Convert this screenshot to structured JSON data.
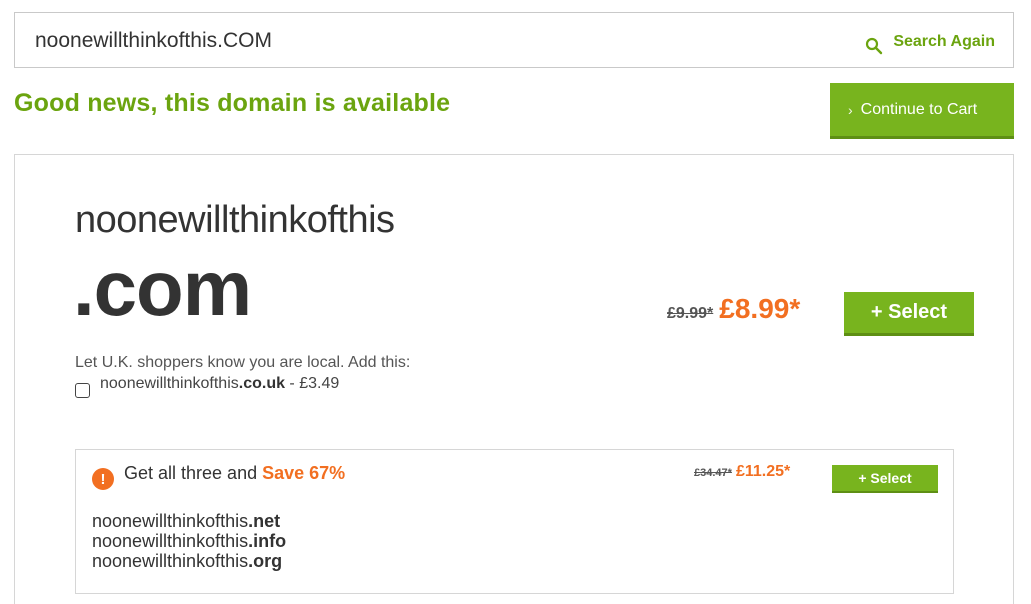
{
  "search": {
    "value": "noonewillthinkofthis.COM",
    "again_label": "Search Again"
  },
  "result": {
    "headline": "Good news, this domain is available",
    "continue_label": "Continue to Cart",
    "domain_name": "noonewillthinkofthis",
    "tld": ".com",
    "old_price": "£9.99*",
    "new_price": "£8.99*",
    "select_label": "+ Select"
  },
  "local": {
    "note": "Let U.K. shoppers know you are local. Add this:",
    "name": "noonewillthinkofthis",
    "tld": ".co.uk",
    "price": " - £3.49"
  },
  "bundle": {
    "title": "Get all three and ",
    "save": "Save 67%",
    "old_price": "£34.47*",
    "new_price": "£11.25*",
    "select_label": "+ Select",
    "items": [
      {
        "name": "noonewillthinkofthis",
        "tld": ".net"
      },
      {
        "name": "noonewillthinkofthis",
        "tld": ".info"
      },
      {
        "name": "noonewillthinkofthis",
        "tld": ".org"
      }
    ]
  },
  "colors": {
    "brand_green": "#78b41e",
    "headline_green": "#6ba40f",
    "price_orange": "#f26f21"
  }
}
